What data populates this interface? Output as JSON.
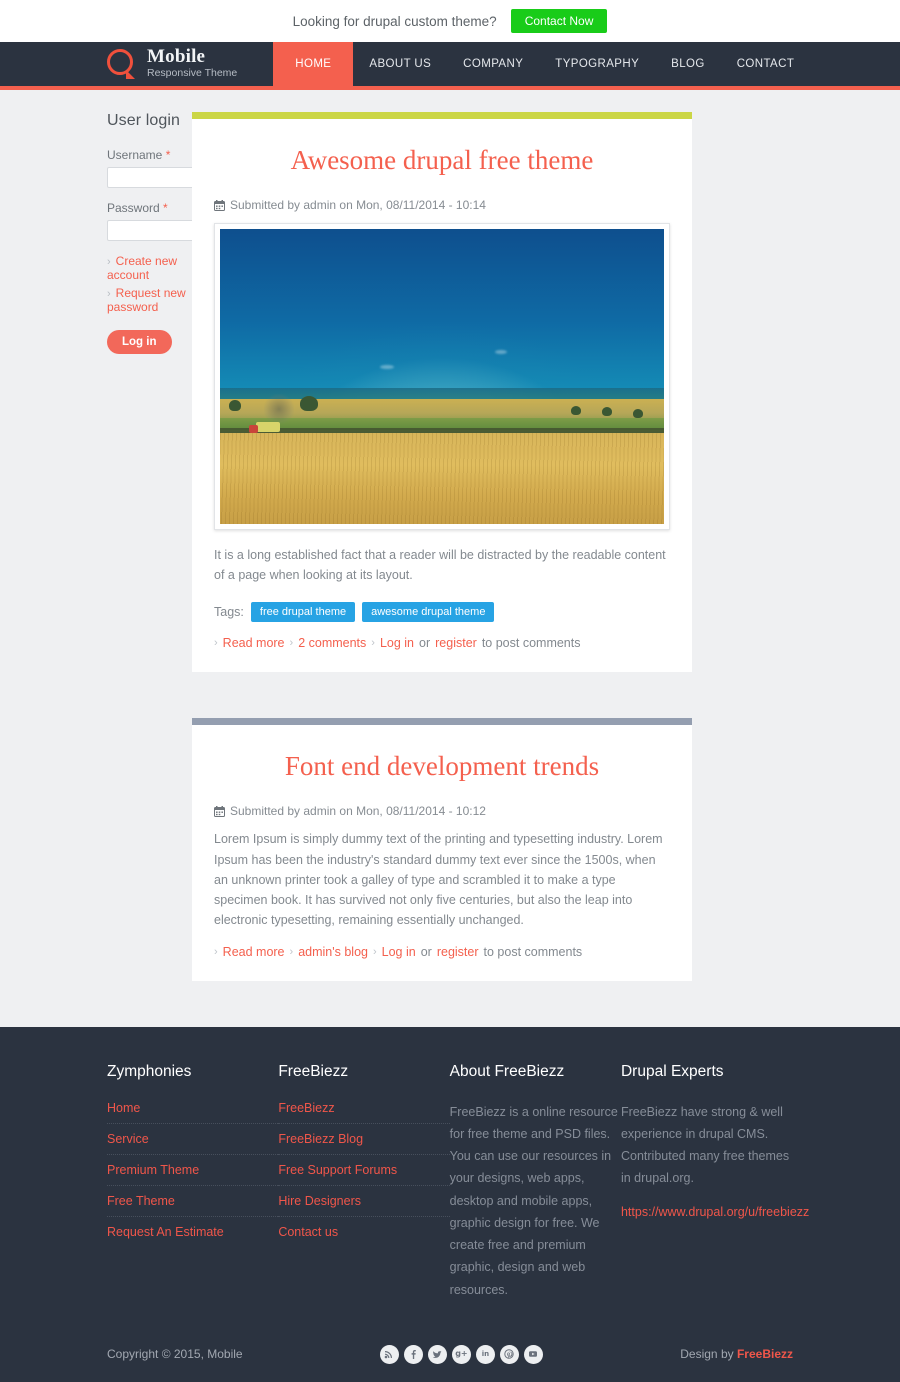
{
  "topbar": {
    "text": "Looking for drupal custom theme?",
    "button_label": "Contact Now",
    "button_color": "#19cc19"
  },
  "header": {
    "brand_name": "Mobile",
    "brand_tagline": "Responsive Theme",
    "logo_color": "#f0503c",
    "accent_color": "#f4604e",
    "background": "#2b3340",
    "nav": [
      {
        "label": "HOME",
        "active": true
      },
      {
        "label": "ABOUT US",
        "active": false
      },
      {
        "label": "COMPANY",
        "active": false
      },
      {
        "label": "TYPOGRAPHY",
        "active": false
      },
      {
        "label": "BLOG",
        "active": false
      },
      {
        "label": "CONTACT",
        "active": false
      }
    ]
  },
  "sidebar": {
    "title": "User login",
    "username_label": "Username",
    "username_value": "",
    "password_label": "Password",
    "password_value": "",
    "required_mark": "*",
    "links": [
      {
        "label": "Create new account"
      },
      {
        "label": "Request new password"
      }
    ],
    "login_button": "Log in"
  },
  "articles": [
    {
      "bar_color": "#cbd645",
      "title": "Awesome drupal free theme",
      "submitted": "Submitted by admin on Mon, 08/11/2014 - 10:14",
      "has_image": true,
      "image_alt": "Wheat field with harvester under blue sky",
      "body": "It is a long established fact that a reader will be distracted by the readable content of a page when looking at its layout.",
      "tags_label": "Tags:",
      "tags": [
        "free drupal theme",
        "awesome drupal theme"
      ],
      "links": [
        {
          "label": "Read more",
          "chevron": true
        },
        {
          "label": "2 comments",
          "chevron": true
        },
        {
          "label": "Log in",
          "chevron": true
        }
      ],
      "links_mid_text": "or",
      "links_register": "register",
      "links_tail_text": "to post comments"
    },
    {
      "bar_color": "#949eb0",
      "title": "Font end development trends",
      "submitted": "Submitted by admin on Mon, 08/11/2014 - 10:12",
      "has_image": false,
      "body": "Lorem Ipsum is simply dummy text of the printing and typesetting industry. Lorem Ipsum has been the industry's standard dummy text ever since the 1500s, when an unknown printer took a galley of type and scrambled it to make a type specimen book. It has survived not only five centuries, but also the leap into electronic typesetting, remaining essentially unchanged.",
      "links": [
        {
          "label": "Read more",
          "chevron": true
        },
        {
          "label": "admin's blog",
          "chevron": true
        },
        {
          "label": "Log in",
          "chevron": true
        }
      ],
      "links_mid_text": "or",
      "links_register": "register",
      "links_tail_text": "to post comments"
    }
  ],
  "footer": {
    "columns": [
      {
        "title": "Zymphonies",
        "type": "links",
        "links": [
          "Home",
          "Service",
          "Premium Theme",
          "Free Theme",
          "Request An Estimate"
        ]
      },
      {
        "title": "FreeBiezz",
        "type": "links",
        "links": [
          "FreeBiezz",
          "FreeBiezz Blog",
          "Free Support Forums",
          "Hire Designers",
          "Contact us"
        ]
      },
      {
        "title": "About FreeBiezz",
        "type": "text",
        "text": "FreeBiezz is a online resource for free theme and PSD files. You can use our resources in your designs, web apps, desktop and mobile apps, graphic design for free. We create free and premium graphic, design and web resources.",
        "url": ""
      },
      {
        "title": "Drupal Experts",
        "type": "text",
        "text": "FreeBiezz have strong & well experience in drupal CMS. Contributed many free themes in drupal.org.",
        "url": "https://www.drupal.org/u/freebiezz"
      }
    ],
    "copyright": "Copyright © 2015, Mobile",
    "socials": [
      {
        "name": "rss-icon",
        "glyph": "⏺"
      },
      {
        "name": "facebook-icon",
        "glyph": "f"
      },
      {
        "name": "twitter-icon",
        "glyph": "ᵗ"
      },
      {
        "name": "google-plus-icon",
        "glyph": "g+"
      },
      {
        "name": "linkedin-icon",
        "glyph": "in"
      },
      {
        "name": "pinterest-icon",
        "glyph": "ⓟ"
      },
      {
        "name": "youtube-icon",
        "glyph": "▶"
      }
    ],
    "design_by_prefix": "Design by",
    "design_by_name": "FreeBiezz"
  }
}
